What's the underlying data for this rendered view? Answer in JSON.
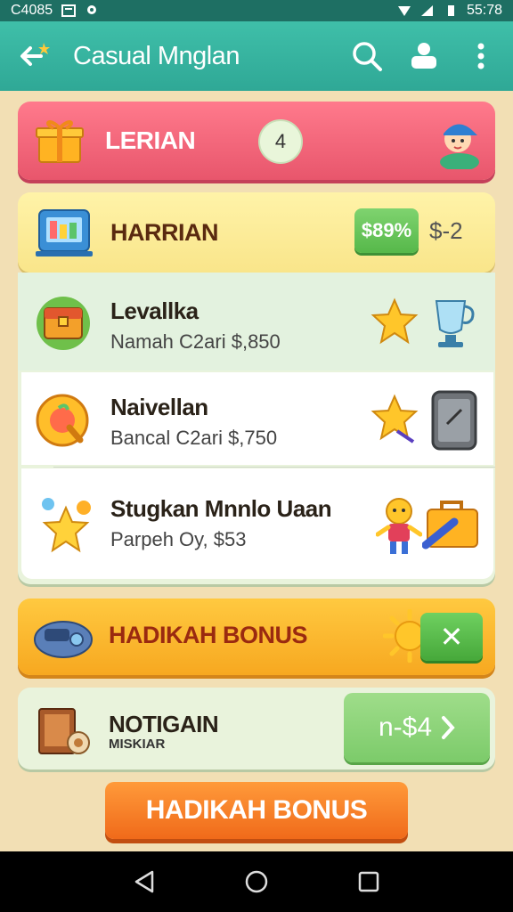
{
  "status_bar": {
    "time_left": "C4085",
    "time_right": "55:78"
  },
  "app_bar": {
    "title": "Casual Mnglan"
  },
  "cards": {
    "lerian": {
      "label": "LERIAN",
      "badge": "4"
    },
    "harrian": {
      "label": "HARRIAN",
      "discount": "$89%",
      "price": "$-2"
    },
    "items": [
      {
        "title": "Levallka",
        "subtitle": "Namah C2ari $,850"
      },
      {
        "title": "Naivellan",
        "subtitle": "Bancal C2ari $,750"
      },
      {
        "title": "Stugkan Mnnlo Uaan",
        "subtitle": "Parpeh Oy, $53"
      }
    ],
    "bonus": {
      "label": "HADIKAH BONUS",
      "close": "✕"
    },
    "notice": {
      "title": "NOTIGAIN",
      "subtitle": "MISKIAR",
      "price": "n-$4"
    }
  },
  "cta": {
    "label": "HADIKAH BONUS"
  },
  "colors": {
    "primary": "#2fa896",
    "accent": "#f06a1a",
    "pink": "#e8566c",
    "yellow": "#f9e58a",
    "gold": "#f7a820"
  }
}
